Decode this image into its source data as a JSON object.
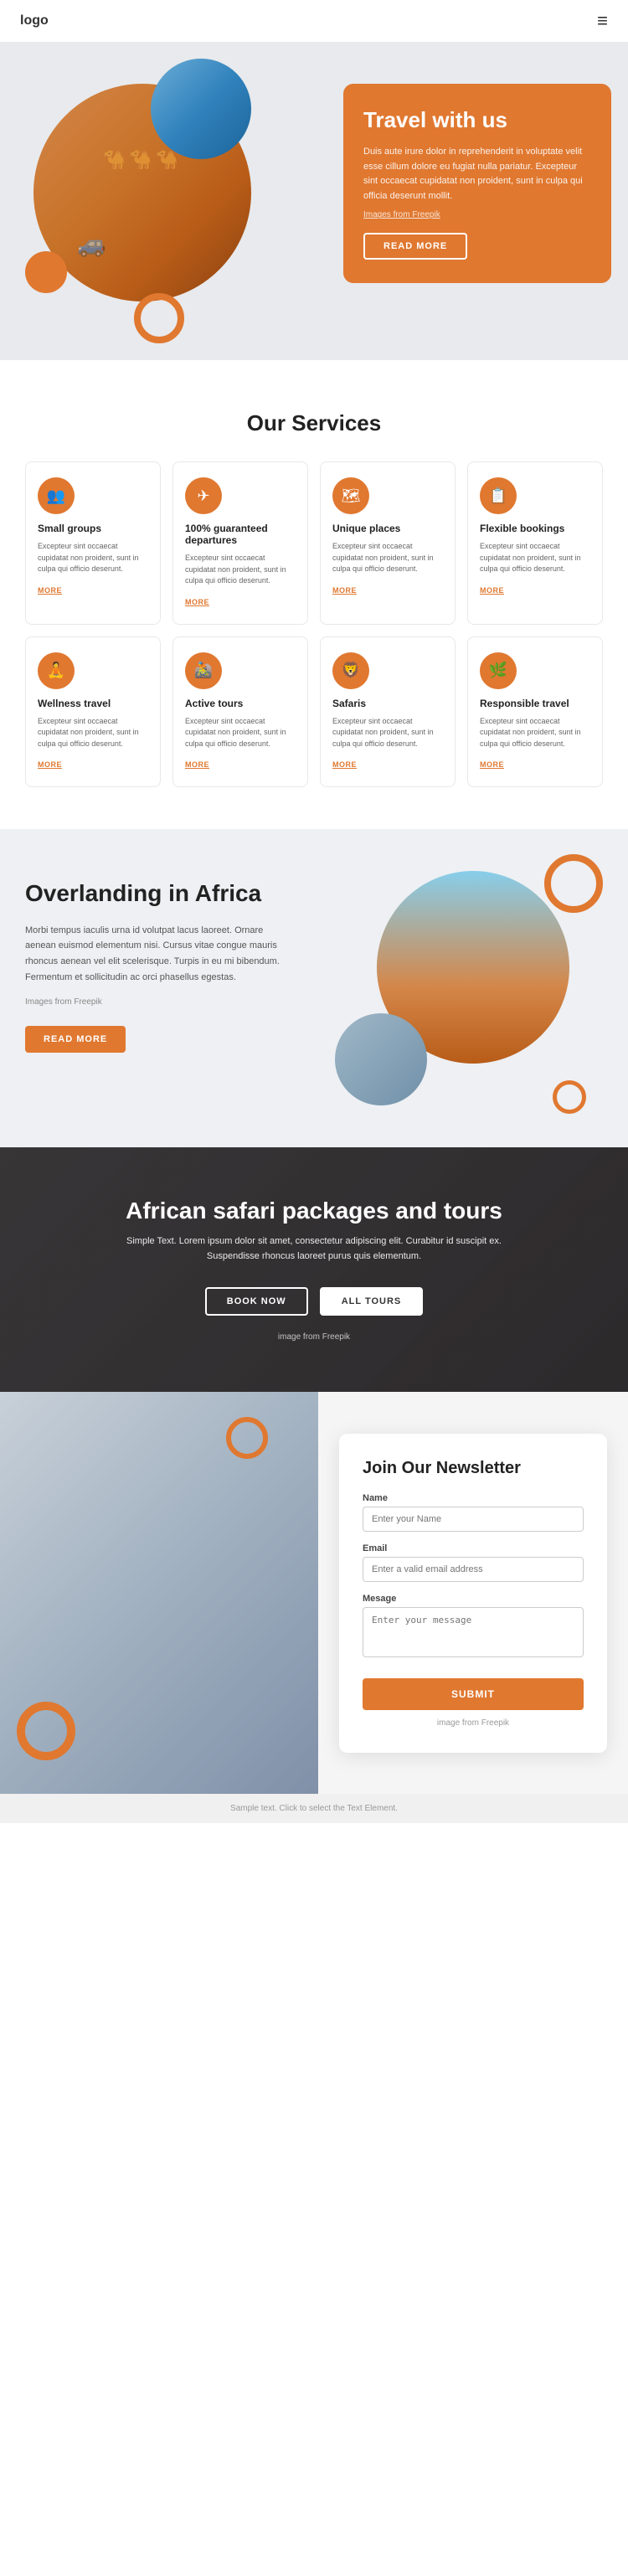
{
  "header": {
    "logo": "logo",
    "hamburger_icon": "≡"
  },
  "hero": {
    "title": "Travel with us",
    "description": "Duis aute irure dolor in reprehenderit in voluptate velit esse cillum dolore eu fugiat nulla pariatur. Excepteur sint occaecat cupidatat non proident, sunt in culpa qui officia deserunt mollit.",
    "image_credit": "Images from Freepik",
    "button_label": "READ MORE"
  },
  "services": {
    "section_title": "Our Services",
    "cards": [
      {
        "icon": "👥",
        "title": "Small groups",
        "description": "Excepteur sint occaecat cupidatat non proident, sunt in culpa qui officio deserunt.",
        "more": "MORE"
      },
      {
        "icon": "✈",
        "title": "100% guaranteed departures",
        "description": "Excepteur sint occaecat cupidatat non proident, sunt in culpa qui officio deserunt.",
        "more": "MORE"
      },
      {
        "icon": "🗺",
        "title": "Unique places",
        "description": "Excepteur sint occaecat cupidatat non proident, sunt in culpa qui officio deserunt.",
        "more": "MORE"
      },
      {
        "icon": "📋",
        "title": "Flexible bookings",
        "description": "Excepteur sint occaecat cupidatat non proident, sunt in culpa qui officio deserunt.",
        "more": "MORE"
      },
      {
        "icon": "🧘",
        "title": "Wellness travel",
        "description": "Excepteur sint occaecat cupidatat non proident, sunt in culpa qui officio deserunt.",
        "more": "MORE"
      },
      {
        "icon": "🚵",
        "title": "Active tours",
        "description": "Excepteur sint occaecat cupidatat non proident, sunt in culpa qui officio deserunt.",
        "more": "MORE"
      },
      {
        "icon": "🦁",
        "title": "Safaris",
        "description": "Excepteur sint occaecat cupidatat non proident, sunt in culpa qui officio deserunt.",
        "more": "MORE"
      },
      {
        "icon": "🌿",
        "title": "Responsible travel",
        "description": "Excepteur sint occaecat cupidatat non proident, sunt in culpa qui officio deserunt.",
        "more": "MORE"
      }
    ]
  },
  "overlanding": {
    "title": "Overlanding in Africa",
    "description1": "Morbi tempus iaculis urna id volutpat lacus laoreet. Ornare aenean euismod elementum nisi. Cursus vitae congue mauris rhoncus aenean vel elit scelerisque. Turpis in eu mi bibendum. Fermentum et sollicitudin ac orci phasellus egestas.",
    "image_credit": "Images from Freepik",
    "button_label": "READ MORE"
  },
  "safari": {
    "title": "African safari packages and tours",
    "description": "Simple Text. Lorem ipsum dolor sit amet, consectetur adipiscing elit. Curabitur id suscipit ex. Suspendisse rhoncus laoreet purus quis elementum.",
    "btn_book": "BOOK NOW",
    "btn_tours": "ALL TOURS",
    "image_credit": "image from Freepik"
  },
  "newsletter": {
    "title": "Join Our Newsletter",
    "name_label": "Name",
    "name_placeholder": "Enter your Name",
    "email_label": "Email",
    "email_placeholder": "Enter a valid email address",
    "message_label": "Mesage",
    "message_placeholder": "Enter your message",
    "submit_label": "SUBMIT",
    "image_credit": "image from Freepik"
  },
  "footer": {
    "note": "Sample text. Click to select the Text Element."
  },
  "colors": {
    "orange": "#e07830",
    "dark": "#222222",
    "light_bg": "#eef0f3",
    "white": "#ffffff"
  }
}
